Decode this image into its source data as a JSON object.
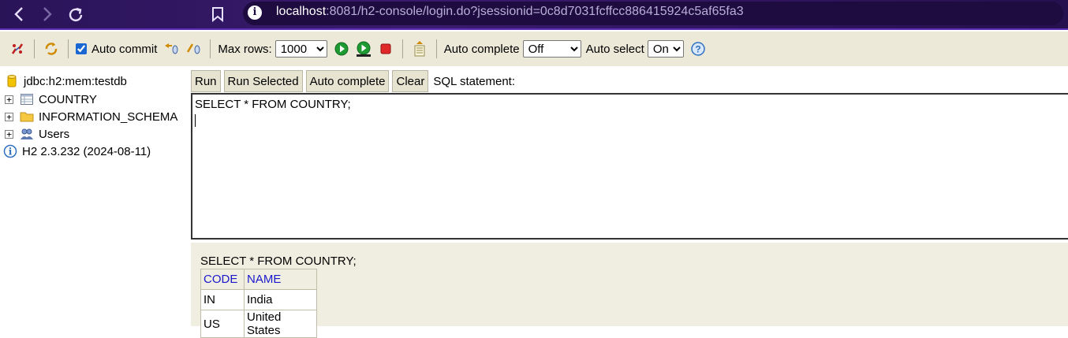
{
  "browser": {
    "url_host": "localhost",
    "url_rest": ":8081/h2-console/login.do?jsessionid=0c8d7031fcffcc886415924c5af65fa3"
  },
  "toolbar": {
    "auto_commit_label": "Auto commit",
    "auto_commit_checked": true,
    "max_rows_label": "Max rows:",
    "max_rows_value": "1000",
    "auto_complete_label": "Auto complete",
    "auto_complete_value": "Off",
    "auto_select_label": "Auto select",
    "auto_select_value": "On"
  },
  "tree": {
    "connection": "jdbc:h2:mem:testdb",
    "items": [
      {
        "label": "COUNTRY",
        "icon": "table-icon"
      },
      {
        "label": "INFORMATION_SCHEMA",
        "icon": "folder-icon"
      },
      {
        "label": "Users",
        "icon": "users-icon"
      }
    ],
    "version": "H2 2.3.232 (2024-08-11)"
  },
  "query": {
    "run_label": "Run",
    "run_selected_label": "Run Selected",
    "auto_complete_label": "Auto complete",
    "clear_label": "Clear",
    "sql_label": "SQL statement:",
    "sql_text": "SELECT * FROM COUNTRY;"
  },
  "result": {
    "query": "SELECT * FROM COUNTRY;",
    "columns": [
      "CODE",
      "NAME"
    ],
    "rows": [
      [
        "IN",
        "India"
      ],
      [
        "US",
        "United States"
      ]
    ]
  }
}
